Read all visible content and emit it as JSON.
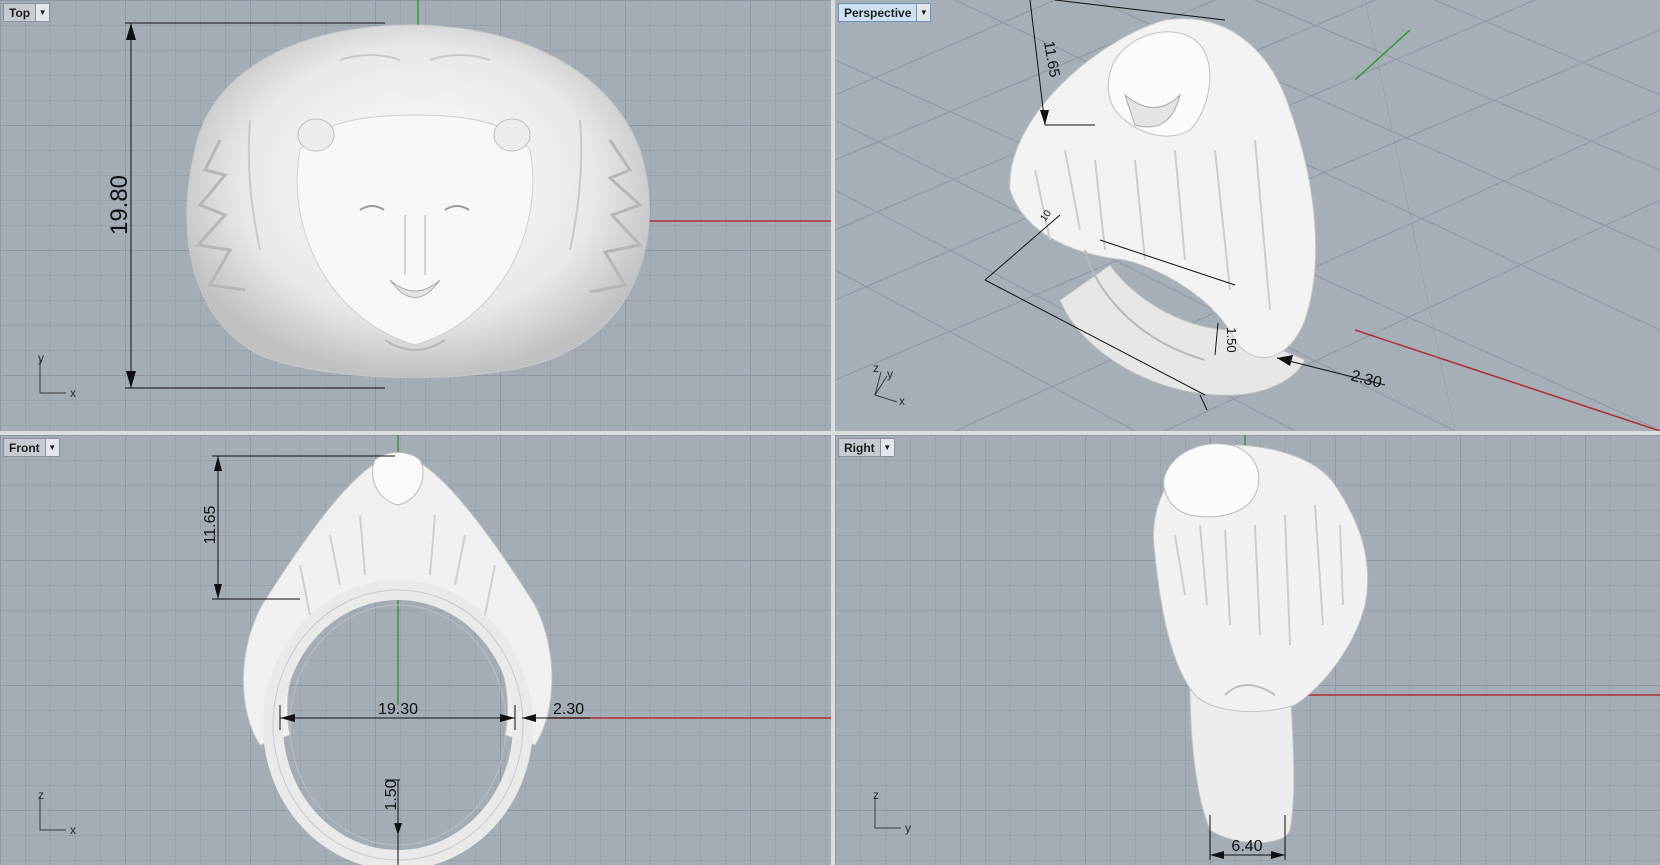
{
  "viewports": {
    "top": {
      "name": "Top",
      "axes": {
        "a": "y",
        "b": "x"
      },
      "dims": {
        "height": "19.80"
      }
    },
    "perspective": {
      "name": "Perspective",
      "axes": {
        "a": "z",
        "b": "y",
        "c": "x"
      },
      "dims": {
        "height": "11.65",
        "thickness": "1.50",
        "width": "2.30",
        "small": "10"
      }
    },
    "front": {
      "name": "Front",
      "axes": {
        "a": "z",
        "b": "x"
      },
      "dims": {
        "height": "11.65",
        "inner": "19.30",
        "band": "2.30",
        "bottom": "1.50"
      }
    },
    "right": {
      "name": "Right",
      "axes": {
        "a": "z",
        "b": "y"
      },
      "dims": {
        "width": "6.40"
      }
    }
  },
  "colors": {
    "background": "#a4acb6",
    "grid_major": "#8f98a3",
    "x_axis": "#b03030",
    "y_axis": "#2f9a2f",
    "model": "#efefef"
  },
  "icons": {
    "dropdown": "chevron-down-icon"
  }
}
